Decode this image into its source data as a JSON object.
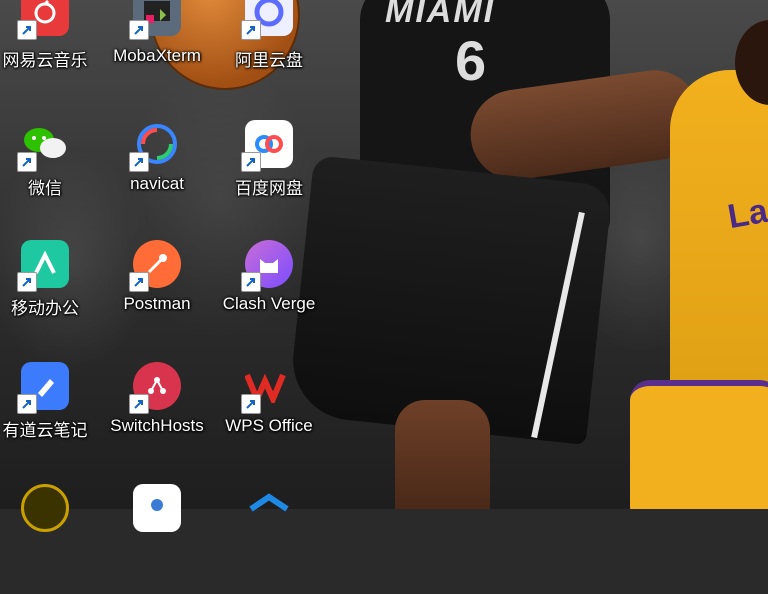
{
  "desktop": {
    "icons": [
      {
        "label": "网易云音乐",
        "icon": "netease-music-icon",
        "color": "#e83a3a"
      },
      {
        "label": "MobaXterm",
        "icon": "mobaxterm-icon",
        "color": "#5b6b7c"
      },
      {
        "label": "阿里云盘",
        "icon": "aliyun-drive-icon",
        "color": "#5c6cff"
      },
      {
        "label": "微信",
        "icon": "wechat-icon",
        "color": "#2dc100"
      },
      {
        "label": "navicat",
        "icon": "navicat-icon",
        "color": "#3a86ff"
      },
      {
        "label": "百度网盘",
        "icon": "baidu-netdisk-icon",
        "color": "#2b8cff"
      },
      {
        "label": "移动办公",
        "icon": "mobile-office-icon",
        "color": "#1ec8a0"
      },
      {
        "label": "Postman",
        "icon": "postman-icon",
        "color": "#ff6c37"
      },
      {
        "label": "Clash Verge",
        "icon": "clash-verge-icon",
        "color": "#9b59f6"
      },
      {
        "label": "有道云笔记",
        "icon": "youdao-note-icon",
        "color": "#3d7bfd"
      },
      {
        "label": "SwitchHosts",
        "icon": "switchhosts-icon",
        "color": "#d8344e"
      },
      {
        "label": "WPS Office",
        "icon": "wps-office-icon",
        "color": "#e02b24"
      },
      {
        "label": "",
        "icon": "app-icon-partial-1",
        "color": "#caa000"
      },
      {
        "label": "",
        "icon": "app-icon-partial-2",
        "color": "#3a7bd5"
      },
      {
        "label": "",
        "icon": "app-icon-partial-3",
        "color": "#1e88e5"
      }
    ]
  },
  "wallpaper": {
    "jersey_text": "MIAMI",
    "jersey_number": "6",
    "laker_text": "La"
  }
}
